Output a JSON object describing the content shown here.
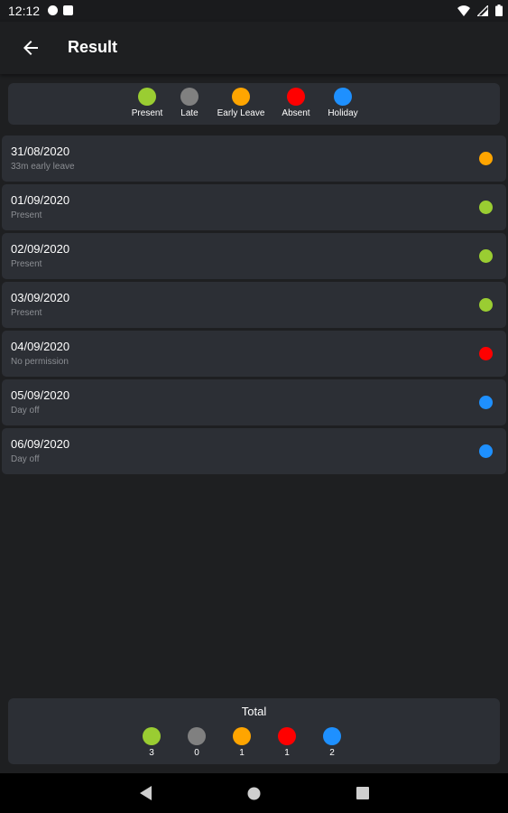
{
  "status": {
    "time": "12:12"
  },
  "appbar": {
    "title": "Result"
  },
  "legend": [
    {
      "label": "Present",
      "color": "#9acd32"
    },
    {
      "label": "Late",
      "color": "#808080"
    },
    {
      "label": "Early Leave",
      "color": "#ffa500"
    },
    {
      "label": "Absent",
      "color": "#ff0000"
    },
    {
      "label": "Holiday",
      "color": "#1e90ff"
    }
  ],
  "records": [
    {
      "date": "31/08/2020",
      "note": "33m early leave",
      "status_color": "#ffa500"
    },
    {
      "date": "01/09/2020",
      "note": "Present",
      "status_color": "#9acd32"
    },
    {
      "date": "02/09/2020",
      "note": "Present",
      "status_color": "#9acd32"
    },
    {
      "date": "03/09/2020",
      "note": "Present",
      "status_color": "#9acd32"
    },
    {
      "date": "04/09/2020",
      "note": "No permission",
      "status_color": "#ff0000"
    },
    {
      "date": "05/09/2020",
      "note": "Day off",
      "status_color": "#1e90ff"
    },
    {
      "date": "06/09/2020",
      "note": "Day off",
      "status_color": "#1e90ff"
    }
  ],
  "totals": {
    "title": "Total",
    "items": [
      {
        "count": "3",
        "color": "#9acd32"
      },
      {
        "count": "0",
        "color": "#808080"
      },
      {
        "count": "1",
        "color": "#ffa500"
      },
      {
        "count": "1",
        "color": "#ff0000"
      },
      {
        "count": "2",
        "color": "#1e90ff"
      }
    ]
  },
  "icons": {
    "status_left": [
      "notification-f-icon",
      "sd-card-icon"
    ],
    "status_right": [
      "wifi-icon",
      "signal-icon",
      "battery-icon"
    ],
    "back": "arrow-back-icon",
    "nav": [
      "nav-back-icon",
      "nav-home-icon",
      "nav-recents-icon"
    ]
  }
}
